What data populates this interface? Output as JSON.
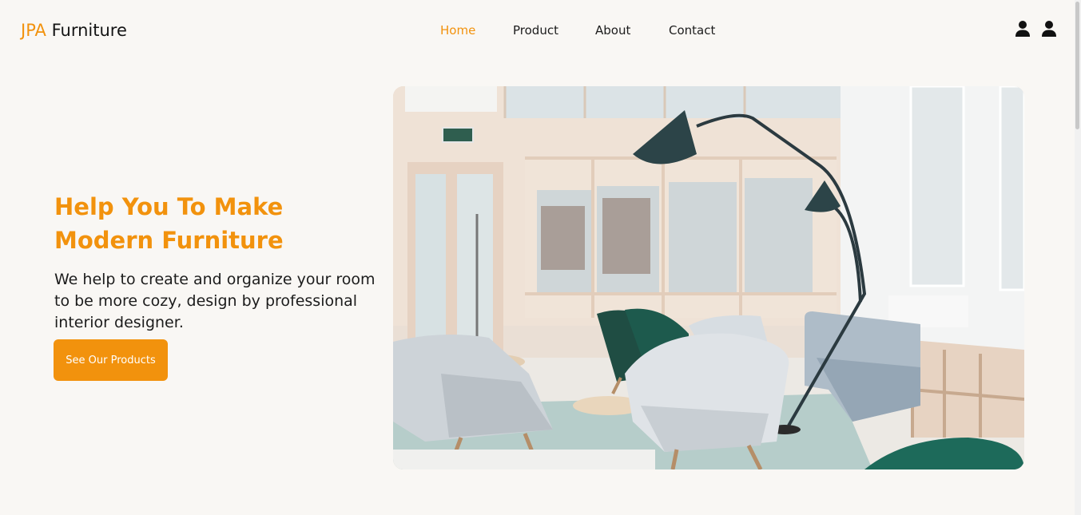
{
  "brand": {
    "prefix": "JPA",
    "name": "Furniture",
    "accent_color": "#f2920d"
  },
  "nav": {
    "items": [
      {
        "label": "Home",
        "active": true
      },
      {
        "label": "Product",
        "active": false
      },
      {
        "label": "About",
        "active": false
      },
      {
        "label": "Contact",
        "active": false
      }
    ]
  },
  "header_icons": [
    "user-icon",
    "user-icon"
  ],
  "hero": {
    "title": "Help You To Make Modern Furniture",
    "description": "We help to create and organize your room to be more cozy, design by professional interior designer.",
    "cta_label": "See Our Products",
    "image": "modern-living-room-photo"
  },
  "colors": {
    "background": "#f9f7f4",
    "accent": "#f2920d",
    "text": "#1c1c1c"
  }
}
